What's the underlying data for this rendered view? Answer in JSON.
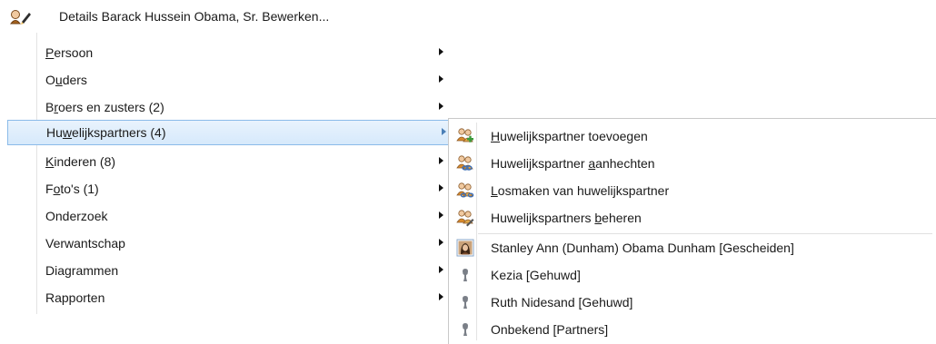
{
  "main_menu": {
    "header": {
      "label": "Details Barack Hussein Obama, Sr. Bewerken..."
    },
    "items": [
      {
        "before": "",
        "mnemonic": "P",
        "after": "ersoon"
      },
      {
        "before": "O",
        "mnemonic": "u",
        "after": "ders"
      },
      {
        "before": "B",
        "mnemonic": "r",
        "after": "oers en zusters (2)"
      },
      {
        "before": "Hu",
        "mnemonic": "w",
        "after": "elijkspartners (4)"
      },
      {
        "before": "",
        "mnemonic": "K",
        "after": "inderen (8)"
      },
      {
        "before": "F",
        "mnemonic": "o",
        "after": "to's (1)"
      },
      {
        "before": "Onderzoek",
        "mnemonic": "",
        "after": ""
      },
      {
        "before": "Verwantschap",
        "mnemonic": "",
        "after": ""
      },
      {
        "before": "Diagrammen",
        "mnemonic": "",
        "after": ""
      },
      {
        "before": "Rapporten",
        "mnemonic": "",
        "after": ""
      }
    ],
    "active_item": "Huwelijkspartners (4)"
  },
  "submenu": {
    "actions": [
      {
        "before": "",
        "mnemonic": "H",
        "after": "uwelijkspartner toevoegen",
        "icon": "add-partner-icon"
      },
      {
        "before": "Huwelijkspartner ",
        "mnemonic": "a",
        "after": "anhechten",
        "icon": "attach-partner-icon"
      },
      {
        "before": "",
        "mnemonic": "L",
        "after": "osmaken van huwelijkspartner",
        "icon": "detach-partner-icon"
      },
      {
        "before": "Huwelijkspartners ",
        "mnemonic": "b",
        "after": "eheren",
        "icon": "manage-partners-icon"
      }
    ],
    "partners": [
      {
        "label": "Stanley Ann (Dunham) Obama Dunham   [Gescheiden]",
        "icon": "photo-portrait-icon"
      },
      {
        "label": "Kezia   [Gehuwd]",
        "icon": "person-silhouette-icon"
      },
      {
        "label": "Ruth Nidesand   [Gehuwd]",
        "icon": "person-silhouette-icon"
      },
      {
        "label": "Onbekend   [Partners]",
        "icon": "person-silhouette-icon"
      }
    ]
  },
  "colors": {
    "highlight_bg": "#d6e9fb",
    "highlight_border": "#8bbbe9",
    "icon_orange": "#d98a2b",
    "icon_green": "#3a9a3a",
    "icon_blue": "#3d6fb6",
    "icon_gray": "#7a7f87"
  }
}
